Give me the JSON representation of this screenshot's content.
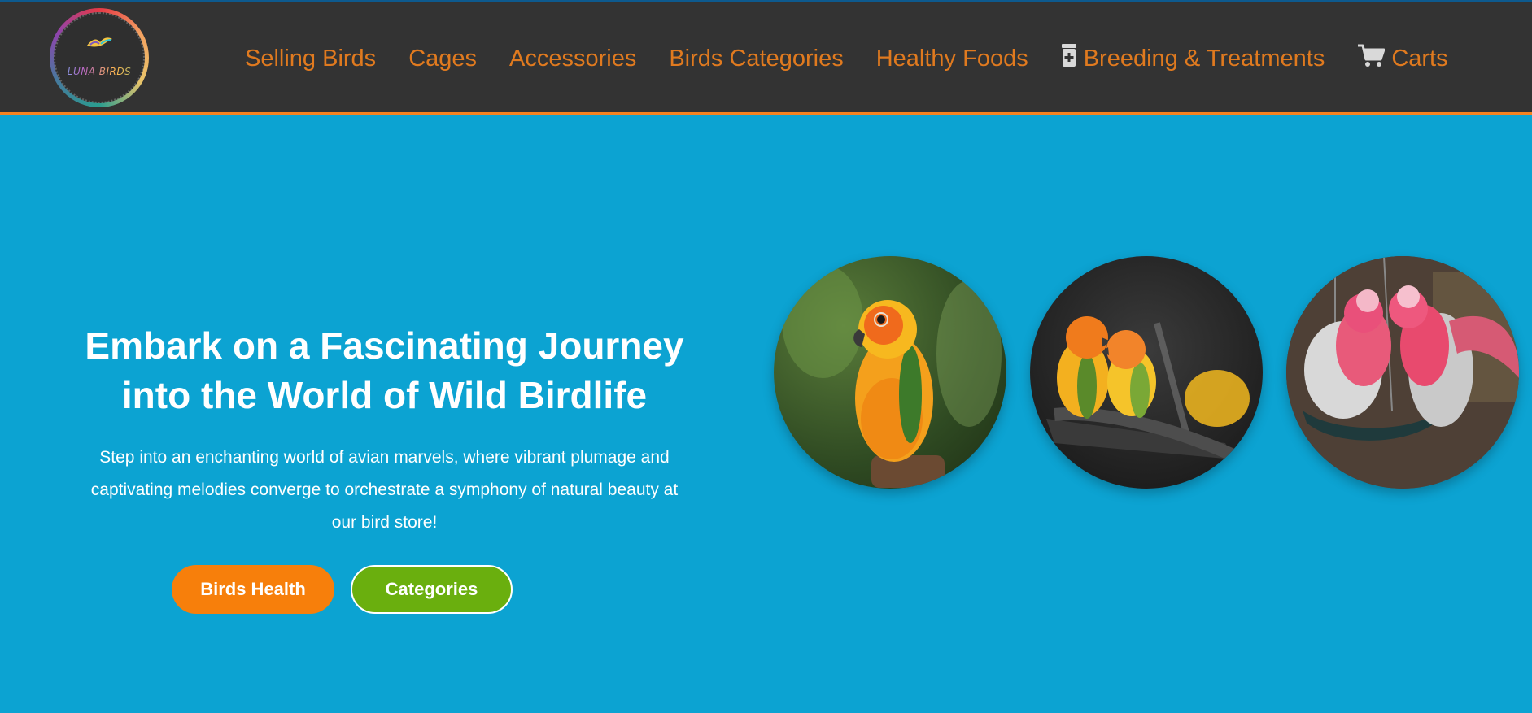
{
  "logo": {
    "text": "LUNA BIRDS",
    "icon": "bird-logo-icon"
  },
  "nav": {
    "items": [
      {
        "label": "Selling Birds"
      },
      {
        "label": "Cages"
      },
      {
        "label": "Accessories"
      },
      {
        "label": "Birds Categories"
      },
      {
        "label": "Healthy Foods"
      },
      {
        "label": "Breeding & Treatments",
        "icon": "medicine-bottle-icon"
      },
      {
        "label": "Carts",
        "icon": "cart-icon"
      }
    ]
  },
  "hero": {
    "title_line1": "Embark on a Fascinating Journey",
    "title_line2": "into the World of Wild Birdlife",
    "desc_line1": "Step into an enchanting world of avian marvels, where vibrant plumage and",
    "desc_line2": "captivating melodies converge to orchestrate a symphony of natural beauty at",
    "desc_line3": "our bird store!",
    "buttons": [
      {
        "label": "Birds Health"
      },
      {
        "label": "Categories"
      }
    ]
  },
  "images": [
    {
      "subject": "sun conure on branch"
    },
    {
      "subject": "pair of sun conures on branch"
    },
    {
      "subject": "pair of galah cockatoos at feeder"
    }
  ],
  "colors": {
    "header_bg": "#333333",
    "nav_text": "#e07a1f",
    "hero_bg": "#0ca3d2",
    "btn_health": "#f77f0b",
    "btn_categories": "#6aaf0e"
  }
}
